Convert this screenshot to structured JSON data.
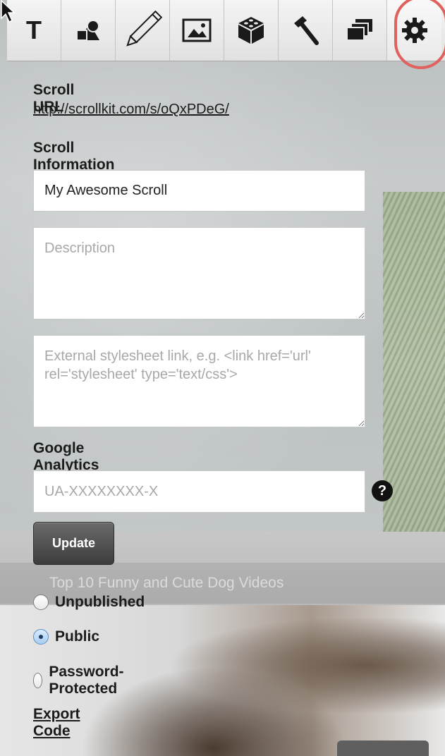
{
  "background": {
    "caption": "Top 10 Funny and Cute Dog Videos"
  },
  "toolbar": {
    "tools": [
      {
        "name": "text-tool",
        "label": "T",
        "icon": "text-icon"
      },
      {
        "name": "shapes-tool",
        "icon": "shapes-icon"
      },
      {
        "name": "draw-tool",
        "icon": "pencil-icon"
      },
      {
        "name": "image-tool",
        "icon": "image-icon"
      },
      {
        "name": "embed-tool",
        "icon": "cube-icon"
      },
      {
        "name": "hammer-tool",
        "icon": "hammer-icon"
      },
      {
        "name": "layers-tool",
        "icon": "layers-icon"
      },
      {
        "name": "settings-tool",
        "icon": "gear-icon",
        "selected": true
      }
    ],
    "highlight_color": "#e0625f"
  },
  "settings": {
    "scroll_url_label": "Scroll URL",
    "scroll_url": "http://scrollkit.com/s/oQxPDeG/",
    "seo_label": "Scroll Information (SEO)",
    "title_value": "My Awesome Scroll",
    "description_placeholder": "Description",
    "stylesheet_placeholder": "External stylesheet link, e.g. <link href='url' rel='stylesheet' type='text/css'>",
    "analytics_label": "Google Analytics ID",
    "analytics_placeholder": "UA-XXXXXXXX-X",
    "help_symbol": "?",
    "update_label": "Update",
    "visibility_options": [
      {
        "label": "Unpublished",
        "checked": false
      },
      {
        "label": "Public",
        "checked": true
      },
      {
        "label": "Password-Protected",
        "checked": false
      }
    ],
    "export_label": "Export Code"
  }
}
